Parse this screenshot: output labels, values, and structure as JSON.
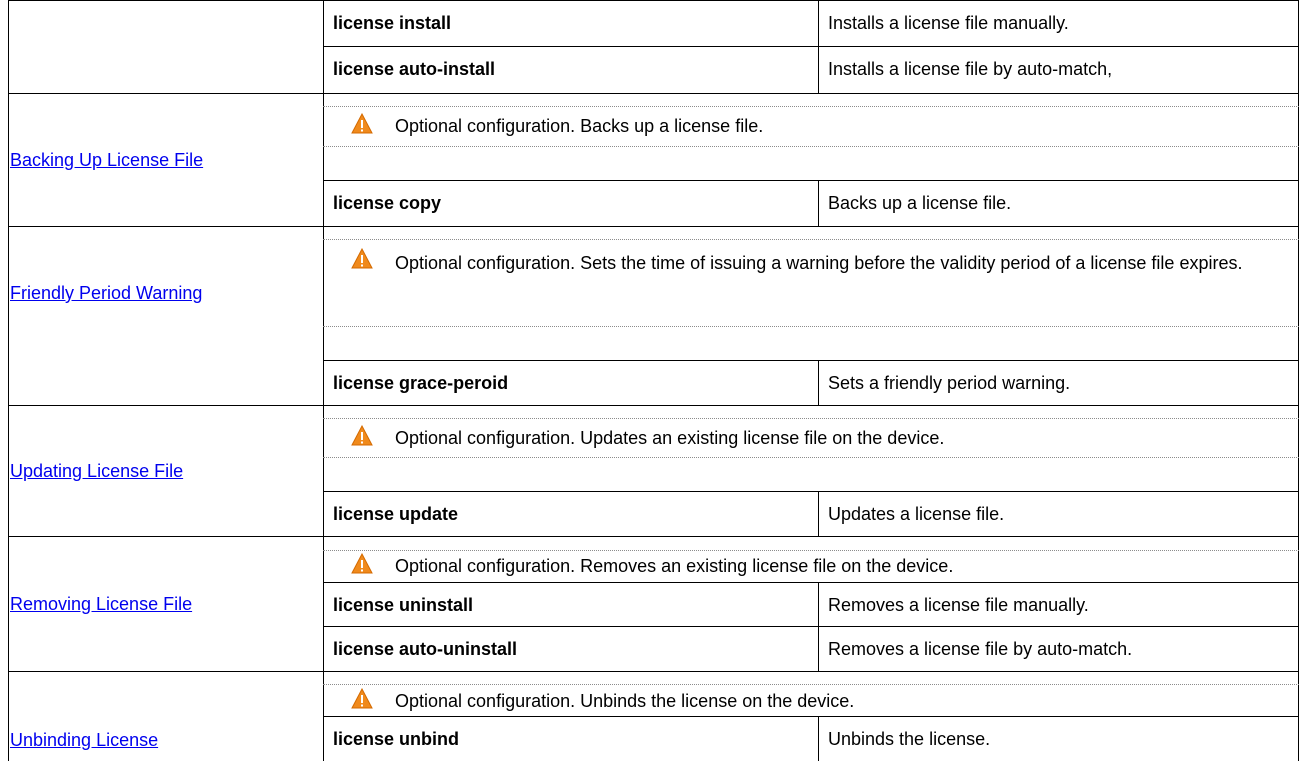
{
  "rows": [
    {
      "section": "",
      "note": "",
      "commands": [
        {
          "command": "license install",
          "description": "Installs a license file manually."
        },
        {
          "command": "license auto-install",
          "description": "Installs a license file by auto-match,"
        }
      ]
    },
    {
      "section": "Backing Up License File",
      "note": "Optional configuration. Backs up a license file.",
      "commands": [
        {
          "command": "license copy",
          "description": "Backs up a license file."
        }
      ]
    },
    {
      "section": "Friendly Period Warning",
      "note": "Optional configuration. Sets the time of issuing a warning before the validity period of a license file expires.",
      "commands": [
        {
          "command": "license grace-peroid",
          "description": "Sets a friendly period warning."
        }
      ]
    },
    {
      "section": "Updating License File",
      "note": "Optional configuration. Updates an existing license file on the device.",
      "commands": [
        {
          "command": "license update",
          "description": "Updates a license file."
        }
      ]
    },
    {
      "section": "Removing License File",
      "note": "Optional configuration. Removes an existing license file on the device.",
      "commands": [
        {
          "command": "license uninstall",
          "description": "Removes a license file manually."
        },
        {
          "command": "license auto-uninstall",
          "description": "Removes a license file by auto-match."
        }
      ]
    },
    {
      "section": "Unbinding License",
      "note": "Optional configuration. Unbinds the license on the device.",
      "commands": [
        {
          "command": "license unbind",
          "description": "Unbinds the license."
        }
      ]
    }
  ],
  "colors": {
    "link": "#0000ee",
    "warning_icon": "#f08a1c",
    "border": "#000000",
    "dotted_rule": "#8c8c8c"
  },
  "icons": {
    "note_icon": "warning-triangle-icon"
  }
}
